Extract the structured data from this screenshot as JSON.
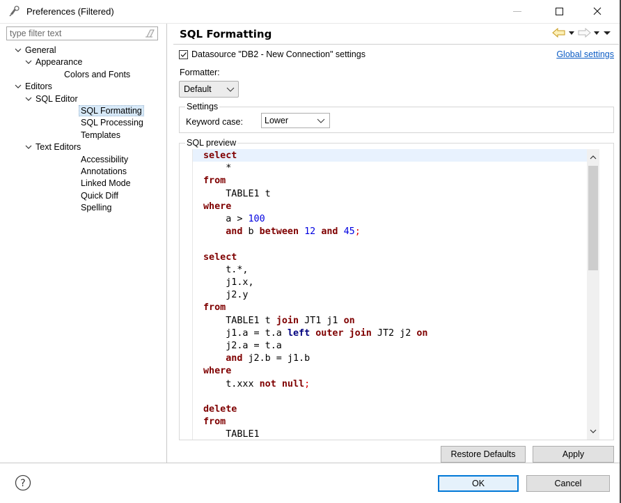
{
  "window": {
    "title": "Preferences (Filtered)"
  },
  "filter": {
    "placeholder": "type filter text"
  },
  "tree": [
    {
      "label": "General",
      "level": 0,
      "expanded": true
    },
    {
      "label": "Appearance",
      "level": 1,
      "expanded": true
    },
    {
      "label": "Colors and Fonts",
      "level": 2
    },
    {
      "label": "Editors",
      "level": 0,
      "expanded": true
    },
    {
      "label": "SQL Editor",
      "level": 1,
      "expanded": true
    },
    {
      "label": "SQL Formatting",
      "level": 2,
      "selected": true
    },
    {
      "label": "SQL Processing",
      "level": 2
    },
    {
      "label": "Templates",
      "level": 2
    },
    {
      "label": "Text Editors",
      "level": 1,
      "expanded": true
    },
    {
      "label": "Accessibility",
      "level": 2
    },
    {
      "label": "Annotations",
      "level": 2
    },
    {
      "label": "Linked Mode",
      "level": 2
    },
    {
      "label": "Quick Diff",
      "level": 2
    },
    {
      "label": "Spelling",
      "level": 2
    }
  ],
  "page": {
    "title": "SQL Formatting",
    "datasource_label": "Datasource \"DB2 - New Connection\" settings",
    "datasource_checked": true,
    "global_settings_link": "Global settings",
    "formatter_label": "Formatter:",
    "formatter_value": "Default",
    "settings_group": "Settings",
    "keyword_case_label": "Keyword case:",
    "keyword_case_value": "Lower",
    "preview_group": "SQL preview",
    "restore_defaults": "Restore Defaults",
    "apply": "Apply"
  },
  "sql_preview": [
    [
      [
        "kw",
        "select"
      ]
    ],
    [
      [
        "t",
        "    *"
      ]
    ],
    [
      [
        "kw",
        "from"
      ]
    ],
    [
      [
        "t",
        "    TABLE1 t"
      ]
    ],
    [
      [
        "kw",
        "where"
      ]
    ],
    [
      [
        "t",
        "    a > "
      ],
      [
        "num",
        "100"
      ]
    ],
    [
      [
        "t",
        "    "
      ],
      [
        "kw",
        "and"
      ],
      [
        "t",
        " b "
      ],
      [
        "kw",
        "between"
      ],
      [
        "t",
        " "
      ],
      [
        "num",
        "12"
      ],
      [
        "t",
        " "
      ],
      [
        "kw",
        "and"
      ],
      [
        "t",
        " "
      ],
      [
        "num",
        "45"
      ],
      [
        "semi",
        ";"
      ]
    ],
    [
      [
        "t",
        ""
      ]
    ],
    [
      [
        "kw",
        "select"
      ]
    ],
    [
      [
        "t",
        "    t.*,"
      ]
    ],
    [
      [
        "t",
        "    j1.x,"
      ]
    ],
    [
      [
        "t",
        "    j2.y"
      ]
    ],
    [
      [
        "kw",
        "from"
      ]
    ],
    [
      [
        "t",
        "    TABLE1 t "
      ],
      [
        "kw",
        "join"
      ],
      [
        "t",
        " JT1 j1 "
      ],
      [
        "kw",
        "on"
      ]
    ],
    [
      [
        "t",
        "    j1.a = t.a "
      ],
      [
        "kw2",
        "left"
      ],
      [
        "t",
        " "
      ],
      [
        "kw",
        "outer"
      ],
      [
        "t",
        " "
      ],
      [
        "kw",
        "join"
      ],
      [
        "t",
        " JT2 j2 "
      ],
      [
        "kw",
        "on"
      ]
    ],
    [
      [
        "t",
        "    j2.a = t.a"
      ]
    ],
    [
      [
        "t",
        "    "
      ],
      [
        "kw",
        "and"
      ],
      [
        "t",
        " j2.b = j1.b"
      ]
    ],
    [
      [
        "kw",
        "where"
      ]
    ],
    [
      [
        "t",
        "    t.xxx "
      ],
      [
        "kw",
        "not"
      ],
      [
        "t",
        " "
      ],
      [
        "kw",
        "null"
      ],
      [
        "semi",
        ";"
      ]
    ],
    [
      [
        "t",
        ""
      ]
    ],
    [
      [
        "kw",
        "delete"
      ]
    ],
    [
      [
        "kw",
        "from"
      ]
    ],
    [
      [
        "t",
        "    TABLE1"
      ]
    ]
  ],
  "footer": {
    "ok": "OK",
    "cancel": "Cancel"
  },
  "icons": {
    "help": "help-icon",
    "back": "back-arrow-icon",
    "forward": "forward-arrow-icon"
  },
  "colors": {
    "keyword": "#7f0000",
    "number": "#0000e0",
    "link": "#0a5bc4",
    "selection": "#d7e9f8"
  }
}
